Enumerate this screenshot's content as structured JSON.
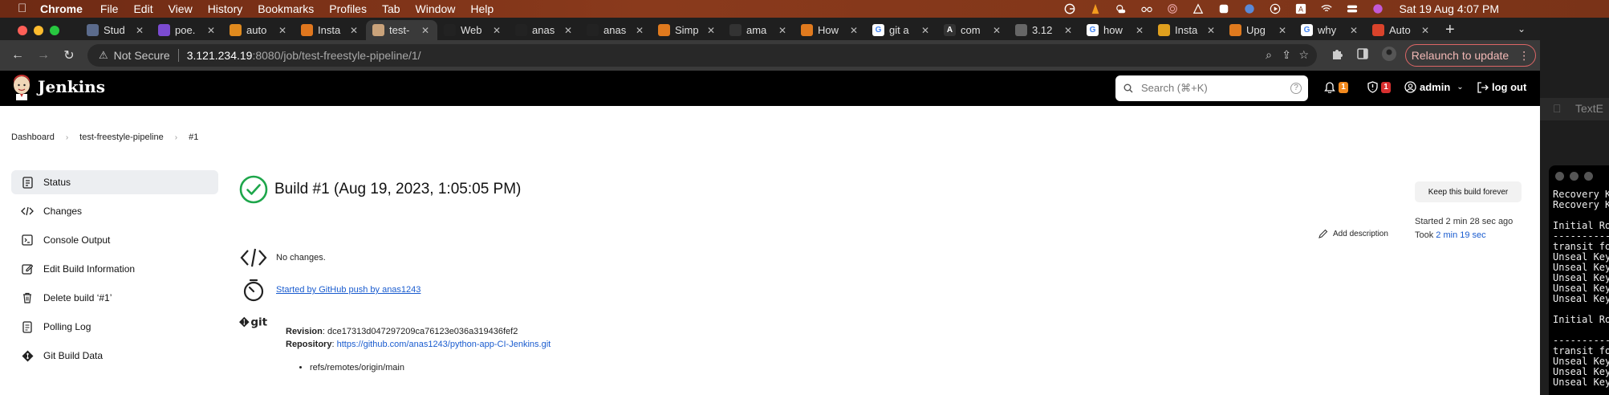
{
  "menubar": {
    "app": "Chrome",
    "items": [
      "File",
      "Edit",
      "View",
      "History",
      "Bookmarks",
      "Profiles",
      "Tab",
      "Window",
      "Help"
    ],
    "clock": "Sat 19 Aug  4:07 PM"
  },
  "tabs": [
    {
      "label": "Stud",
      "color": "#5b6b8c",
      "glyph": ""
    },
    {
      "label": "poe.",
      "color": "#7b4bd1",
      "glyph": ""
    },
    {
      "label": "auto",
      "color": "#e08a1e",
      "glyph": ""
    },
    {
      "label": "Insta",
      "color": "#e0771e",
      "glyph": ""
    },
    {
      "label": "test-",
      "color": "#c9a27a",
      "glyph": "",
      "active": true
    },
    {
      "label": "Web",
      "color": "#222",
      "glyph": ""
    },
    {
      "label": "anas",
      "color": "#222",
      "glyph": ""
    },
    {
      "label": "anas",
      "color": "#222",
      "glyph": ""
    },
    {
      "label": "Simp",
      "color": "#e07a1e",
      "glyph": ""
    },
    {
      "label": "ama",
      "color": "#333",
      "glyph": ""
    },
    {
      "label": "How",
      "color": "#e07a1e",
      "glyph": ""
    },
    {
      "label": "git a",
      "color": "#fff",
      "glyph": "G"
    },
    {
      "label": "com",
      "color": "#333",
      "glyph": "A"
    },
    {
      "label": "3.12",
      "color": "#666",
      "glyph": ""
    },
    {
      "label": "how",
      "color": "#fff",
      "glyph": "G"
    },
    {
      "label": "Insta",
      "color": "#e0a01e",
      "glyph": ""
    },
    {
      "label": "Upg",
      "color": "#e07a1e",
      "glyph": ""
    },
    {
      "label": "why",
      "color": "#fff",
      "glyph": "G"
    },
    {
      "label": "Auto",
      "color": "#d9432b",
      "glyph": ""
    }
  ],
  "address": {
    "security": "Not Secure",
    "host": "3.121.234.19",
    "path": ":8080/job/test-freestyle-pipeline/1/"
  },
  "relaunch_label": "Relaunch to update",
  "jenkins": {
    "title": "Jenkins",
    "search_placeholder": "Search (⌘+K)",
    "notifications_count": "1",
    "security_count": "1",
    "user": "admin",
    "logout": "log out"
  },
  "breadcrumb": [
    "Dashboard",
    "test-freestyle-pipeline",
    "#1"
  ],
  "sidebar": [
    {
      "label": "Status",
      "icon": "status-icon",
      "active": true
    },
    {
      "label": "Changes",
      "icon": "code-icon"
    },
    {
      "label": "Console Output",
      "icon": "terminal-icon"
    },
    {
      "label": "Edit Build Information",
      "icon": "edit-icon"
    },
    {
      "label": "Delete build ‘#1’",
      "icon": "trash-icon"
    },
    {
      "label": "Polling Log",
      "icon": "document-icon"
    },
    {
      "label": "Git Build Data",
      "icon": "git-icon"
    }
  ],
  "build": {
    "title": "Build #1 (Aug 19, 2023, 1:05:05 PM)",
    "keep_label": "Keep this build forever",
    "started": "Started 2 min 28 sec ago",
    "took_prefix": "Took ",
    "took_link": "2 min 19 sec",
    "add_description": "Add description",
    "changes": "No changes.",
    "cause": "Started by GitHub push by anas1243",
    "revision_label": "Revision",
    "revision": "dce17313d047297209ca76123e036a319436fef2",
    "repository_label": "Repository",
    "repository": "https://github.com/anas1243/python-app-CI-Jenkins.git",
    "ref": "refs/remotes/origin/main",
    "git_logo": "git"
  },
  "textedit_label": "TextE",
  "terminal_lines": [
    "Recovery Ke",
    "Recovery Ke",
    "",
    "Initial Roo",
    "-----------",
    "transit for",
    "Unseal Key ",
    "Unseal Key ",
    "Unseal Key ",
    "Unseal Key ",
    "Unseal Key ",
    "",
    "Initial Roo",
    "",
    "-----------",
    "transit for",
    "Unseal Key ",
    "Unseal Key ",
    "Unseal Key "
  ],
  "colors": {
    "success": "#1ea64b",
    "link": "#1a5ccf",
    "notification_badge": "#f28a1e",
    "security_badge": "#d83030"
  }
}
